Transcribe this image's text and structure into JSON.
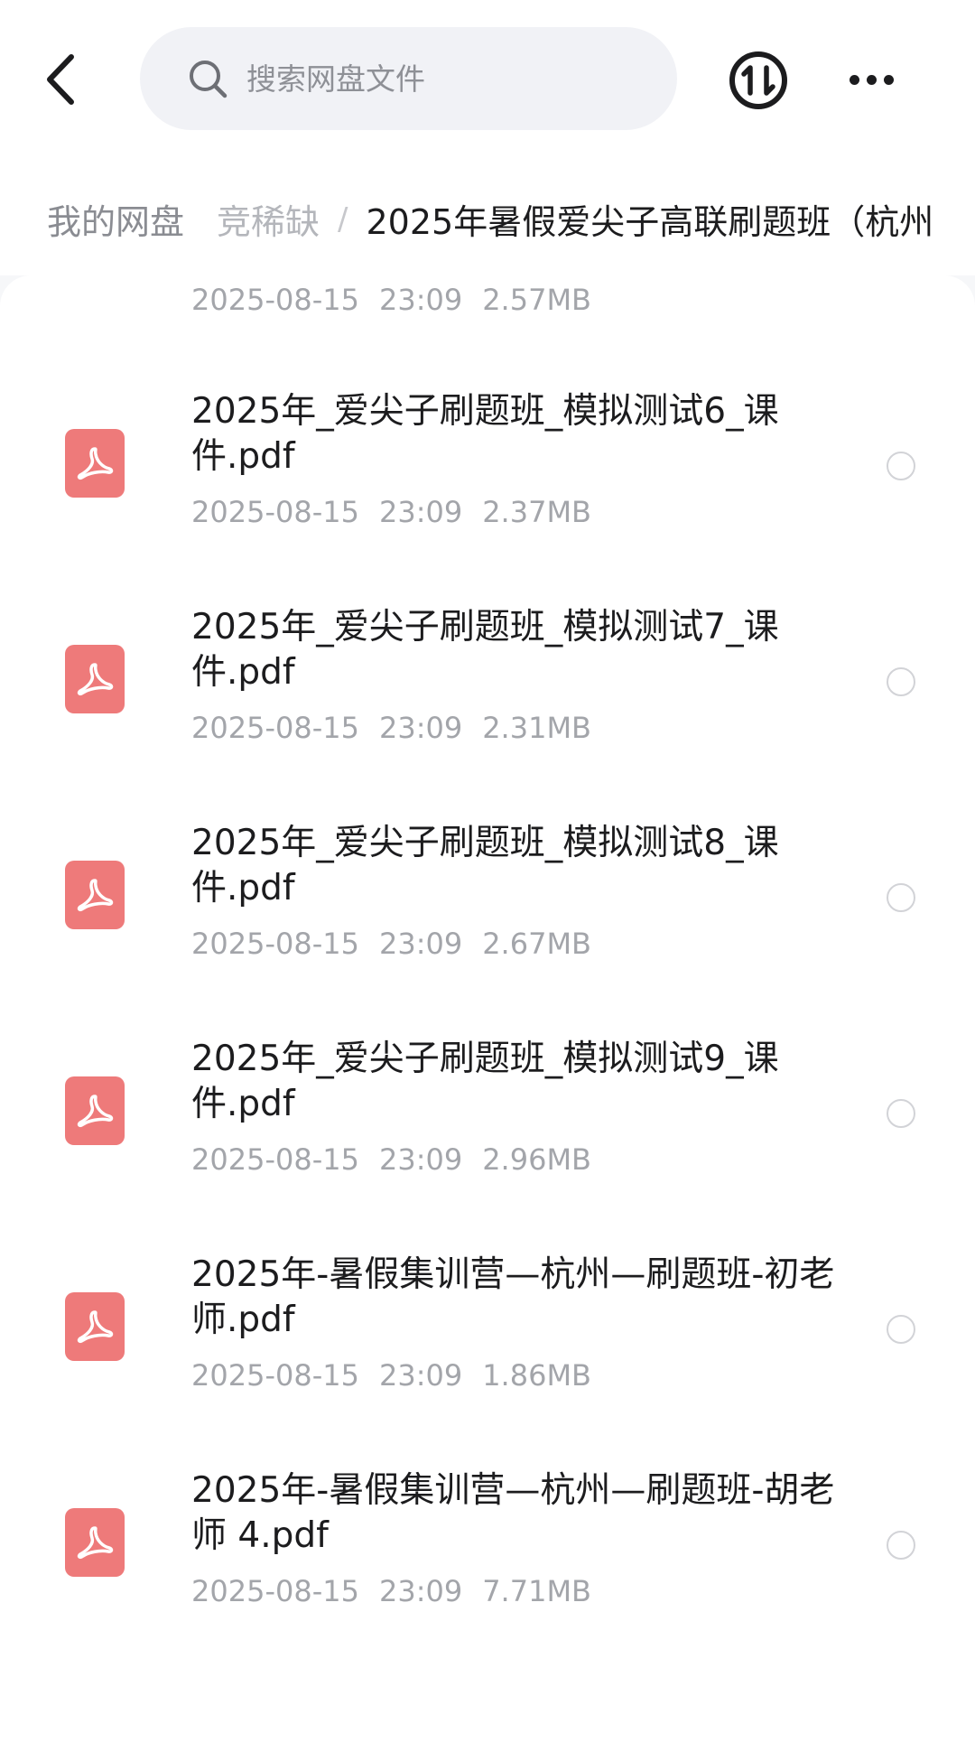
{
  "header": {
    "search_placeholder": "搜索网盘文件"
  },
  "breadcrumb": {
    "root": "我的网盘",
    "middle": "竞稀缺",
    "separator": "/",
    "current": "2025年暑假爱尖子高联刷题班（杭州"
  },
  "list": {
    "partial": {
      "date": "2025-08-15",
      "time": "23:09",
      "size": "2.57MB"
    },
    "files": [
      {
        "name": "2025年_爱尖子刷题班_模拟测试6_课件.pdf",
        "date": "2025-08-15",
        "time": "23:09",
        "size": "2.37MB"
      },
      {
        "name": "2025年_爱尖子刷题班_模拟测试7_课件.pdf",
        "date": "2025-08-15",
        "time": "23:09",
        "size": "2.31MB"
      },
      {
        "name": "2025年_爱尖子刷题班_模拟测试8_课件.pdf",
        "date": "2025-08-15",
        "time": "23:09",
        "size": "2.67MB"
      },
      {
        "name": "2025年_爱尖子刷题班_模拟测试9_课件.pdf",
        "date": "2025-08-15",
        "time": "23:09",
        "size": "2.96MB"
      },
      {
        "name": "2025年-暑假集训营—杭州—刷题班-初老师.pdf",
        "date": "2025-08-15",
        "time": "23:09",
        "size": "1.86MB"
      },
      {
        "name": "2025年-暑假集训营—杭州—刷题班-胡老师 4.pdf",
        "date": "2025-08-15",
        "time": "23:09",
        "size": "7.71MB"
      }
    ]
  },
  "colors": {
    "pdf_icon": "#ee7a7a",
    "meta_text": "#a3a5aa",
    "search_bg": "#f1f2f6"
  }
}
